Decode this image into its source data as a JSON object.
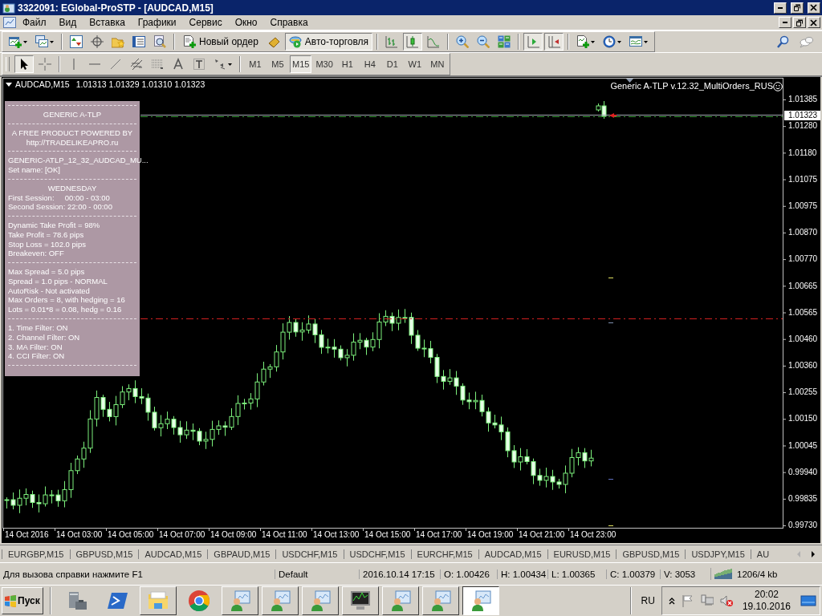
{
  "window": {
    "title": "3322091: EGlobal-ProSTP - [AUDCAD,M15]"
  },
  "menu": [
    "Файл",
    "Вид",
    "Вставка",
    "Графики",
    "Сервис",
    "Окно",
    "Справка"
  ],
  "toolbar": {
    "new_order": "Новый ордер",
    "auto_trading": {
      "label": "Авто-торговля",
      "on": true
    },
    "chart_types": [
      {
        "selected": false
      },
      {
        "selected": true
      },
      {
        "selected": false
      }
    ],
    "autoscroll": {
      "on": true
    },
    "chart_shift": {
      "on": true
    }
  },
  "drawing_tools": [
    {
      "selected": true
    },
    {
      "selected": false
    }
  ],
  "periods": [
    {
      "label": "M1",
      "selected": false
    },
    {
      "label": "M5",
      "selected": false
    },
    {
      "label": "M15",
      "selected": true
    },
    {
      "label": "M30",
      "selected": false
    },
    {
      "label": "H1",
      "selected": false
    },
    {
      "label": "H4",
      "selected": false
    },
    {
      "label": "D1",
      "selected": false
    },
    {
      "label": "W1",
      "selected": false
    },
    {
      "label": "MN",
      "selected": false
    }
  ],
  "chart": {
    "symbol": "AUDCAD,M15",
    "quotes": "1.01313 1.01329 1.01310 1.01323",
    "expert": "Generic A-TLP v.12.32_MultiOrders_RUS",
    "current_price": "1.01323",
    "price_labels": [
      "1.01385",
      "1.01280",
      "1.01180",
      "1.01075",
      "1.00975",
      "1.00870",
      "1.00770",
      "1.00665",
      "1.00565",
      "1.00460",
      "1.00360",
      "1.00255",
      "1.00150",
      "1.00045",
      "0.99940",
      "0.99835",
      "0.99730"
    ],
    "time_labels": [
      "14 Oct 2016",
      "14 Oct 03:00",
      "14 Oct 05:00",
      "14 Oct 07:00",
      "14 Oct 09:00",
      "14 Oct 11:00",
      "14 Oct 13:00",
      "14 Oct 15:00",
      "14 Oct 17:00",
      "14 Oct 19:00",
      "14 Oct 21:00",
      "14 Oct 23:00"
    ]
  },
  "info_panel": {
    "sections": [
      [
        {
          "text": "GENERIC A-TLP",
          "kind": "heading"
        }
      ],
      [
        {
          "text": "A FREE PRODUCT POWERED BY",
          "kind": "heading"
        },
        {
          "text": "http://TRADELIKEAPRO.ru",
          "kind": "heading"
        }
      ],
      [
        {
          "text": "GENERIC-ATLP_12_32_AUDCAD_MU...",
          "kind": "line"
        },
        {
          "text": "Set name: [OK]",
          "kind": "line"
        }
      ],
      [
        {
          "text": "WEDNESDAY",
          "kind": "heading"
        },
        {
          "text": "First Session:     00:00 - 03:00",
          "kind": "line"
        },
        {
          "text": "Second Session: 22:00 - 00:00",
          "kind": "line"
        }
      ],
      [
        {
          "text": "Dynamic Take Profit = 98%",
          "kind": "line"
        },
        {
          "text": "Take Profit = 78.6 pips",
          "kind": "line"
        },
        {
          "text": "Stop Loss = 102.0 pips",
          "kind": "line"
        },
        {
          "text": "Breakeven: OFF",
          "kind": "line"
        }
      ],
      [
        {
          "text": "Max Spread = 5.0 pips",
          "kind": "line"
        },
        {
          "text": "Spread = 1.0 pips - NORMAL",
          "kind": "line"
        },
        {
          "text": "AutoRisk - Not activated",
          "kind": "line"
        },
        {
          "text": "Max Orders = 8, with hedging = 16",
          "kind": "line"
        },
        {
          "text": "Lots = 0.01*8 = 0.08, hedg = 0.16",
          "kind": "line"
        }
      ],
      [
        {
          "text": "1. Time Filter: ON",
          "kind": "line"
        },
        {
          "text": "2. Channel Filter: ON",
          "kind": "line"
        },
        {
          "text": "3. MA Filter: ON",
          "kind": "line"
        },
        {
          "text": "4. CCI Filter: ON",
          "kind": "line"
        }
      ]
    ]
  },
  "symbol_tabs": [
    "EURGBP,M15",
    "GBPUSD,M15",
    "AUDCAD,M15",
    "GBPAUD,M15",
    "USDCHF,M15",
    "USDCHF,M15",
    "EURCHF,M15",
    "AUDCAD,M15",
    "EURUSD,M15",
    "GBPUSD,M15",
    "USDJPY,M15",
    "AU"
  ],
  "status_bar": {
    "help": "Для вызова справки нажмите F1",
    "profile": "Default",
    "datetime": "2016.10.14 17:15",
    "open": "O: 1.00426",
    "high": "H: 1.00434",
    "low": "L: 1.00365",
    "close": "C: 1.00379",
    "volume": "V: 3053",
    "traffic": "1206/4 kb"
  },
  "taskbar": {
    "start": "Пуск",
    "tasks": [
      {
        "kind": "trader",
        "selected": false
      },
      {
        "kind": "trader",
        "selected": false
      },
      {
        "kind": "trader",
        "selected": false
      },
      {
        "kind": "monitor",
        "selected": false
      },
      {
        "kind": "trader",
        "selected": false
      },
      {
        "kind": "trader",
        "selected": false
      },
      {
        "kind": "trader",
        "selected": true
      }
    ],
    "language": "RU",
    "time": "20:02",
    "date": "19.10.2016"
  }
}
